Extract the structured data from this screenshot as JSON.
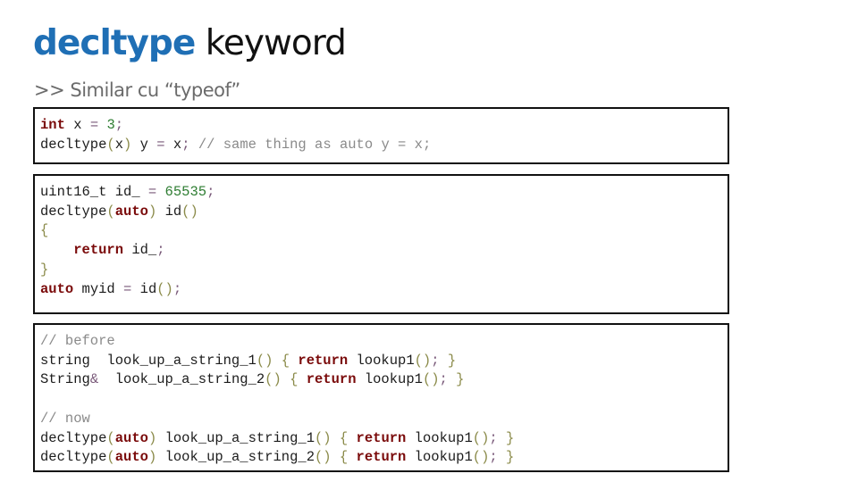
{
  "title": {
    "keyword": "decltype",
    "rest": " keyword",
    "keyword_color": "#1f6fb5"
  },
  "subtitle": ">> Similar cu “typeof”",
  "code_blocks": [
    {
      "lines": [
        [
          [
            "k",
            "int"
          ],
          [
            "t",
            " x "
          ],
          [
            "o",
            "="
          ],
          [
            "t",
            " "
          ],
          [
            "n",
            "3"
          ],
          [
            "o",
            ";"
          ]
        ],
        [
          [
            "t",
            "decltype"
          ],
          [
            "p",
            "("
          ],
          [
            "t",
            "x"
          ],
          [
            "p",
            ")"
          ],
          [
            "t",
            " y "
          ],
          [
            "o",
            "="
          ],
          [
            "t",
            " x"
          ],
          [
            "o",
            ";"
          ],
          [
            "t",
            " "
          ],
          [
            "c",
            "// same thing as auto y = x;"
          ]
        ]
      ]
    },
    {
      "lines": [
        [
          [
            "t",
            "uint16_t id_ "
          ],
          [
            "o",
            "="
          ],
          [
            "t",
            " "
          ],
          [
            "n",
            "65535"
          ],
          [
            "o",
            ";"
          ]
        ],
        [
          [
            "t",
            "decltype"
          ],
          [
            "p",
            "("
          ],
          [
            "k",
            "auto"
          ],
          [
            "p",
            ")"
          ],
          [
            "t",
            " id"
          ],
          [
            "p",
            "()"
          ]
        ],
        [
          [
            "p",
            "{"
          ]
        ],
        [
          [
            "t",
            "    "
          ],
          [
            "k",
            "return"
          ],
          [
            "t",
            " id_"
          ],
          [
            "o",
            ";"
          ]
        ],
        [
          [
            "p",
            "}"
          ]
        ],
        [
          [
            "k",
            "auto"
          ],
          [
            "t",
            " myid "
          ],
          [
            "o",
            "="
          ],
          [
            "t",
            " id"
          ],
          [
            "p",
            "()"
          ],
          [
            "o",
            ";"
          ]
        ]
      ]
    },
    {
      "lines": [
        [
          [
            "c",
            "// before"
          ]
        ],
        [
          [
            "t",
            "string  look_up_a_string_1"
          ],
          [
            "p",
            "()"
          ],
          [
            "t",
            " "
          ],
          [
            "p",
            "{"
          ],
          [
            "t",
            " "
          ],
          [
            "k",
            "return"
          ],
          [
            "t",
            " lookup1"
          ],
          [
            "p",
            "()"
          ],
          [
            "o",
            ";"
          ],
          [
            "t",
            " "
          ],
          [
            "p",
            "}"
          ]
        ],
        [
          [
            "t",
            "String"
          ],
          [
            "o",
            "&"
          ],
          [
            "t",
            "  look_up_a_string_2"
          ],
          [
            "p",
            "()"
          ],
          [
            "t",
            " "
          ],
          [
            "p",
            "{"
          ],
          [
            "t",
            " "
          ],
          [
            "k",
            "return"
          ],
          [
            "t",
            " lookup1"
          ],
          [
            "p",
            "()"
          ],
          [
            "o",
            ";"
          ],
          [
            "t",
            " "
          ],
          [
            "p",
            "}"
          ]
        ],
        [],
        [
          [
            "c",
            "// now"
          ]
        ],
        [
          [
            "t",
            "decltype"
          ],
          [
            "p",
            "("
          ],
          [
            "k",
            "auto"
          ],
          [
            "p",
            ")"
          ],
          [
            "t",
            " look_up_a_string_1"
          ],
          [
            "p",
            "()"
          ],
          [
            "t",
            " "
          ],
          [
            "p",
            "{"
          ],
          [
            "t",
            " "
          ],
          [
            "k",
            "return"
          ],
          [
            "t",
            " lookup1"
          ],
          [
            "p",
            "()"
          ],
          [
            "o",
            ";"
          ],
          [
            "t",
            " "
          ],
          [
            "p",
            "}"
          ]
        ],
        [
          [
            "t",
            "decltype"
          ],
          [
            "p",
            "("
          ],
          [
            "k",
            "auto"
          ],
          [
            "p",
            ")"
          ],
          [
            "t",
            " look_up_a_string_2"
          ],
          [
            "p",
            "()"
          ],
          [
            "t",
            " "
          ],
          [
            "p",
            "{"
          ],
          [
            "t",
            " "
          ],
          [
            "k",
            "return"
          ],
          [
            "t",
            " lookup1"
          ],
          [
            "p",
            "()"
          ],
          [
            "o",
            ";"
          ],
          [
            "t",
            " "
          ],
          [
            "p",
            "}"
          ]
        ]
      ]
    }
  ]
}
